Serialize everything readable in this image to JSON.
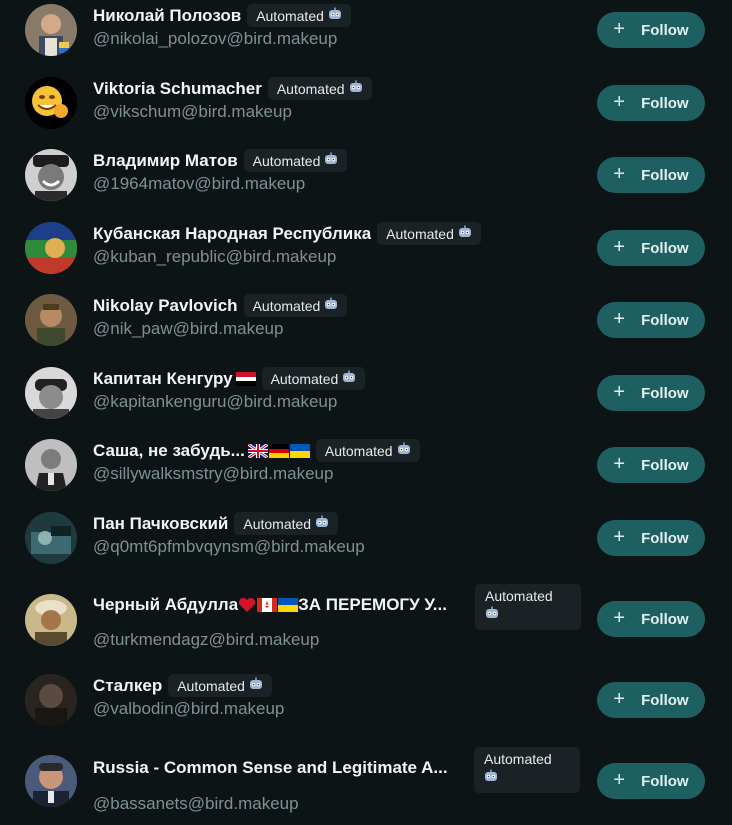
{
  "accounts": [
    {
      "name": "Николай Полозов",
      "handle": "@nikolai_polozov@bird.makeup",
      "badge": "Automated",
      "follow": "Follow"
    },
    {
      "name": "Viktoria Schumacher",
      "handle": "@vikschum@bird.makeup",
      "badge": "Automated",
      "follow": "Follow"
    },
    {
      "name": "Владимир Матов",
      "handle": "@1964matov@bird.makeup",
      "badge": "Automated",
      "follow": "Follow"
    },
    {
      "name": "Кубанская Народная Республика",
      "handle": "@kuban_republic@bird.makeup",
      "badge": "Automated",
      "follow": "Follow"
    },
    {
      "name": "Nikolay Pavlovich",
      "handle": "@nik_paw@bird.makeup",
      "badge": "Automated",
      "follow": "Follow"
    },
    {
      "name": "Капитан Кенгуру",
      "handle": "@kapitankenguru@bird.makeup",
      "badge": "Automated",
      "follow": "Follow",
      "flags": [
        "egypt-flag"
      ]
    },
    {
      "name": "Саша, не забудь...",
      "handle": "@sillywalksmstry@bird.makeup",
      "badge": "Automated",
      "follow": "Follow",
      "flags": [
        "uk-flag",
        "germany-flag",
        "ukraine-flag"
      ]
    },
    {
      "name": "Пан Пачковский",
      "handle": "@q0mt6pfmbvqynsm@bird.makeup",
      "badge": "Automated",
      "follow": "Follow"
    },
    {
      "name": "Черный Абдулла ",
      "name_tail": "ЗА ПЕРЕМОГУ У...",
      "handle": "@turkmendagz@bird.makeup",
      "badge": "Automated",
      "follow": "Follow",
      "flags": [
        "heart-icon",
        "canada-flag",
        "ukraine-flag"
      ]
    },
    {
      "name": "Сталкер",
      "handle": "@valbodin@bird.makeup",
      "badge": "Automated",
      "follow": "Follow"
    },
    {
      "name": "Russia - Common Sense and Legitimate A...",
      "handle": "@bassanets@bird.makeup",
      "badge": "Automated",
      "follow": "Follow"
    }
  ],
  "colors": {
    "background": "#0d1416",
    "follow_button": "#1e5f62",
    "handle_text": "#7f9094",
    "badge_bg": "#1a2226"
  },
  "icons": {
    "follow": "plus-icon",
    "badge": "robot-icon"
  }
}
